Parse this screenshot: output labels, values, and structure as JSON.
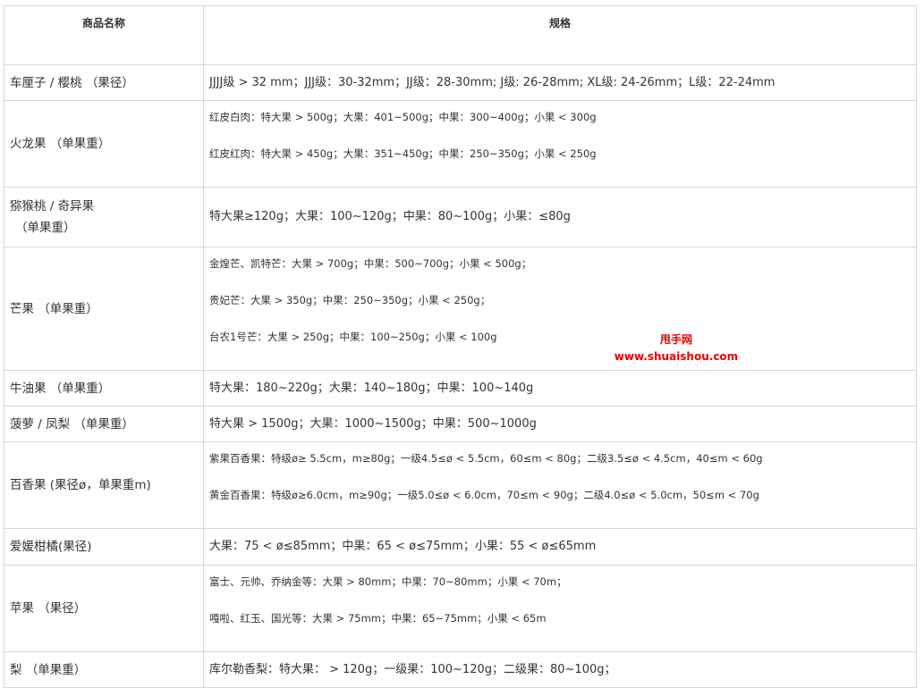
{
  "header": {
    "col_name": "商品名称",
    "col_spec": "规格"
  },
  "rows": [
    {
      "name": "车厘子 / 樱桃 （果径）",
      "spec": [
        "JJJJ级 > 32 mm；JJJ级：30-32mm；JJ级：28-30mm; J级: 26-28mm; XL级: 24-26mm；L级：22-24mm"
      ]
    },
    {
      "name": "火龙果 （单果重）",
      "spec": [
        "红皮白肉：特大果 > 500g；大果：401~500g；中果：300~400g；小果 < 300g",
        "红皮红肉：特大果 > 450g；大果：351~450g；中果：250~350g；小果 < 250g"
      ]
    },
    {
      "name_l1": "猕猴桃 / 奇异果",
      "name_l2": "（单果重）",
      "spec": [
        "特大果≥120g；大果：100~120g；中果：80~100g；小果：≤80g"
      ]
    },
    {
      "name": "芒果 （单果重）",
      "spec": [
        "金煌芒、凯特芒：大果 > 700g；中果：500~700g；小果 < 500g；",
        "贵妃芒：大果 > 350g；中果：250~350g；小果 < 250g；",
        "台农1号芒：大果 > 250g；中果：100~250g；小果 < 100g"
      ]
    },
    {
      "name": "牛油果 （单果重）",
      "spec": [
        "特大果：180~220g；大果：140~180g；中果：100~140g"
      ]
    },
    {
      "name": "菠萝 / 凤梨 （单果重）",
      "spec": [
        "特大果 > 1500g；大果：1000~1500g；中果：500~1000g"
      ]
    },
    {
      "name": "百香果 (果径ø，单果重m)",
      "spec": [
        "紫果百香果：特级ø≥ 5.5cm，m≥80g；一级4.5≤ø < 5.5cm，60≤m < 80g；二级3.5≤ø < 4.5cm，40≤m < 60g",
        "黄金百香果：特级ø≥6.0cm，m≥90g；一级5.0≤ø < 6.0cm，70≤m < 90g；二级4.0≤ø < 5.0cm，50≤m < 70g"
      ]
    },
    {
      "name": "爱媛柑橘(果径)",
      "spec": [
        "大果：75 < ø≤85mm；中果：65 < ø≤75mm；小果：55 < ø≤65mm"
      ]
    },
    {
      "name": "苹果 （果径）",
      "spec": [
        "富士、元帅、乔纳金等：大果 > 80mm；中果：70~80mm；小果 < 70m；",
        "嘎啦、红玉、国光等：大果 > 75mm；中果：65~75mm；小果 < 65m"
      ]
    },
    {
      "name": "梨 （单果重）",
      "spec": [
        "库尔勒香梨：特大果：  > 120g；一级果：100~120g；二级果：80~100g；"
      ]
    }
  ],
  "watermark": {
    "line1": "甩手网",
    "line2": "www.shuaishou.com",
    "color": "#e60000"
  }
}
